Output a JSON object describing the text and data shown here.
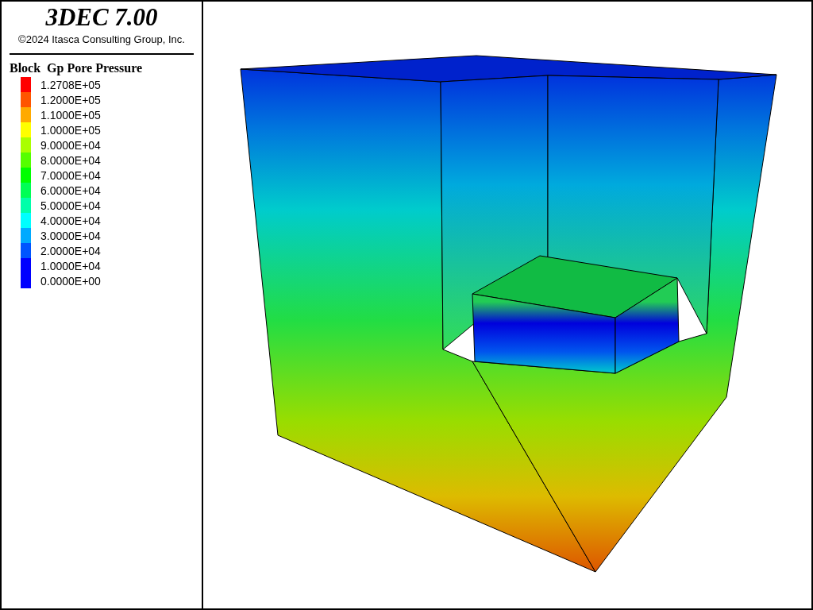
{
  "header": {
    "title": "3DEC 7.00",
    "copyright": "©2024 Itasca Consulting Group, Inc."
  },
  "legend": {
    "title": "Block  Gp Pore Pressure",
    "entries": [
      {
        "label": "1.2708E+05",
        "color": "#ff0000"
      },
      {
        "label": "1.2000E+05",
        "color": "#ff5500"
      },
      {
        "label": "1.1000E+05",
        "color": "#ffaa00"
      },
      {
        "label": "1.0000E+05",
        "color": "#ffff00"
      },
      {
        "label": "9.0000E+04",
        "color": "#aaff00"
      },
      {
        "label": "8.0000E+04",
        "color": "#55ff00"
      },
      {
        "label": "7.0000E+04",
        "color": "#00ff00"
      },
      {
        "label": "6.0000E+04",
        "color": "#00ff55"
      },
      {
        "label": "5.0000E+04",
        "color": "#00ffaa"
      },
      {
        "label": "4.0000E+04",
        "color": "#00ffff"
      },
      {
        "label": "3.0000E+04",
        "color": "#00aaff"
      },
      {
        "label": "2.0000E+04",
        "color": "#0055ff"
      },
      {
        "label": "1.0000E+04",
        "color": "#0000ff"
      },
      {
        "label": "0.0000E+00",
        "color": "#0000ff"
      }
    ]
  }
}
